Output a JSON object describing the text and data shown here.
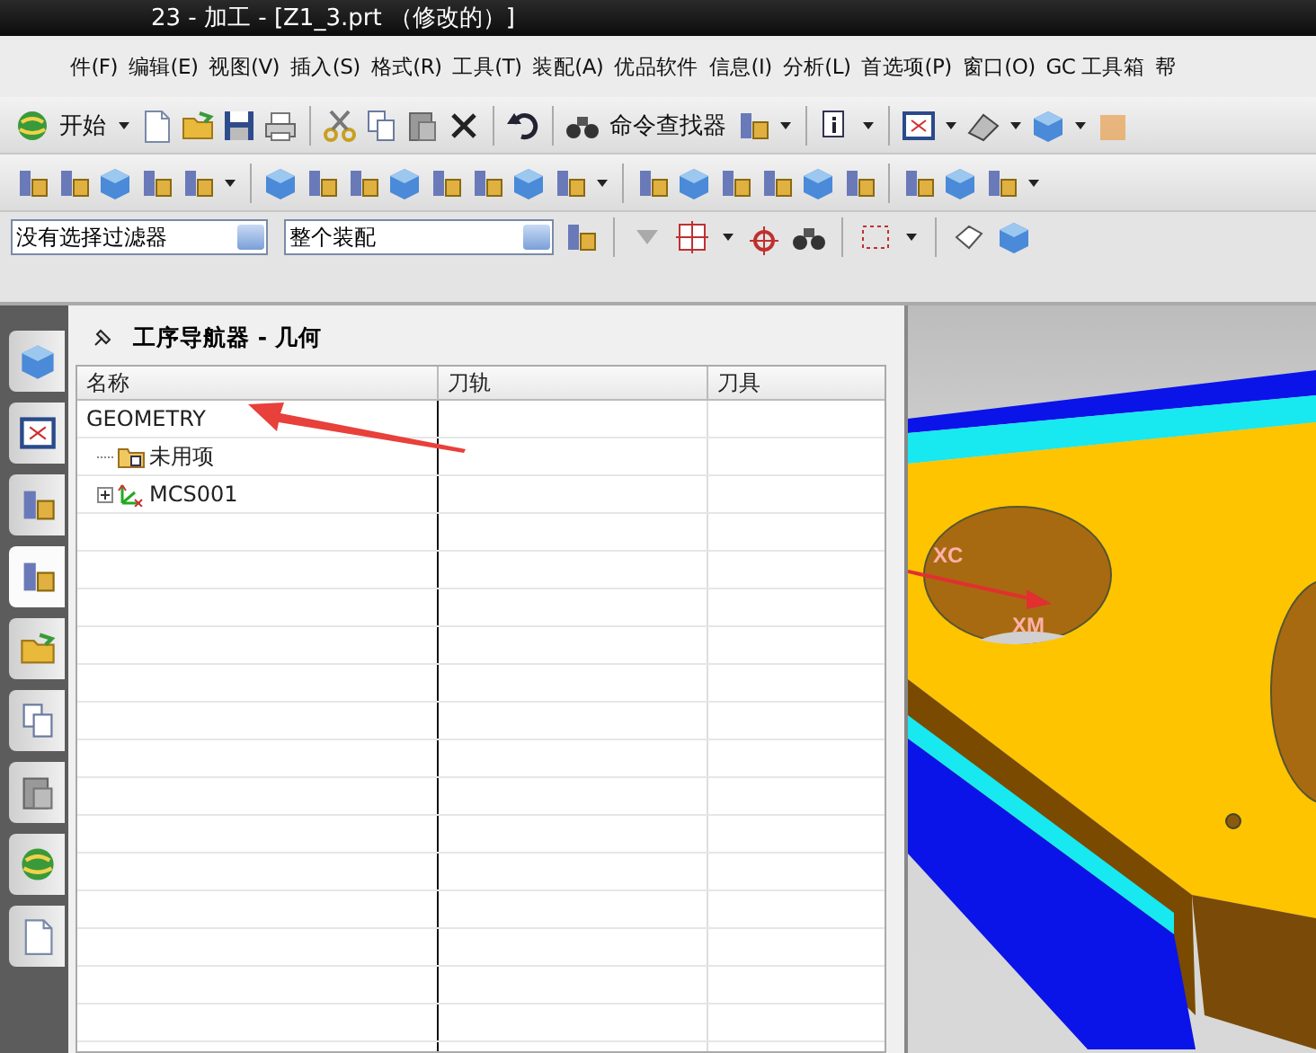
{
  "window": {
    "title": "23 - 加工 - [Z1_3.prt （修改的）]"
  },
  "menu": [
    "件(F)",
    "编辑(E)",
    "视图(V)",
    "插入(S)",
    "格式(R)",
    "工具(T)",
    "装配(A)",
    "优品软件",
    "信息(I)",
    "分析(L)",
    "首选项(P)",
    "窗口(O)",
    "GC 工具箱",
    "帮"
  ],
  "toolbar": {
    "start_button": "开始",
    "command_finder": "命令查找器"
  },
  "filters": [
    {
      "value": "没有选择过滤器"
    },
    {
      "value": "整个装配"
    }
  ],
  "side_tabs": [
    {
      "selected": false
    },
    {
      "selected": false
    },
    {
      "selected": false
    },
    {
      "selected": true
    },
    {
      "selected": false
    },
    {
      "selected": false
    },
    {
      "selected": false
    },
    {
      "selected": false
    },
    {
      "selected": false
    }
  ],
  "navigator": {
    "title": "工序导航器 - 几何",
    "columns": [
      "名称",
      "刀轨",
      "刀具"
    ],
    "tree": [
      {
        "label": "GEOMETRY",
        "children": [
          {
            "label": "未用项",
            "kind": "folder"
          },
          {
            "label": "MCS001",
            "kind": "mcs",
            "expanded": false
          }
        ]
      }
    ]
  },
  "viewport": {
    "axis_labels": [
      "XC",
      "XM"
    ]
  }
}
